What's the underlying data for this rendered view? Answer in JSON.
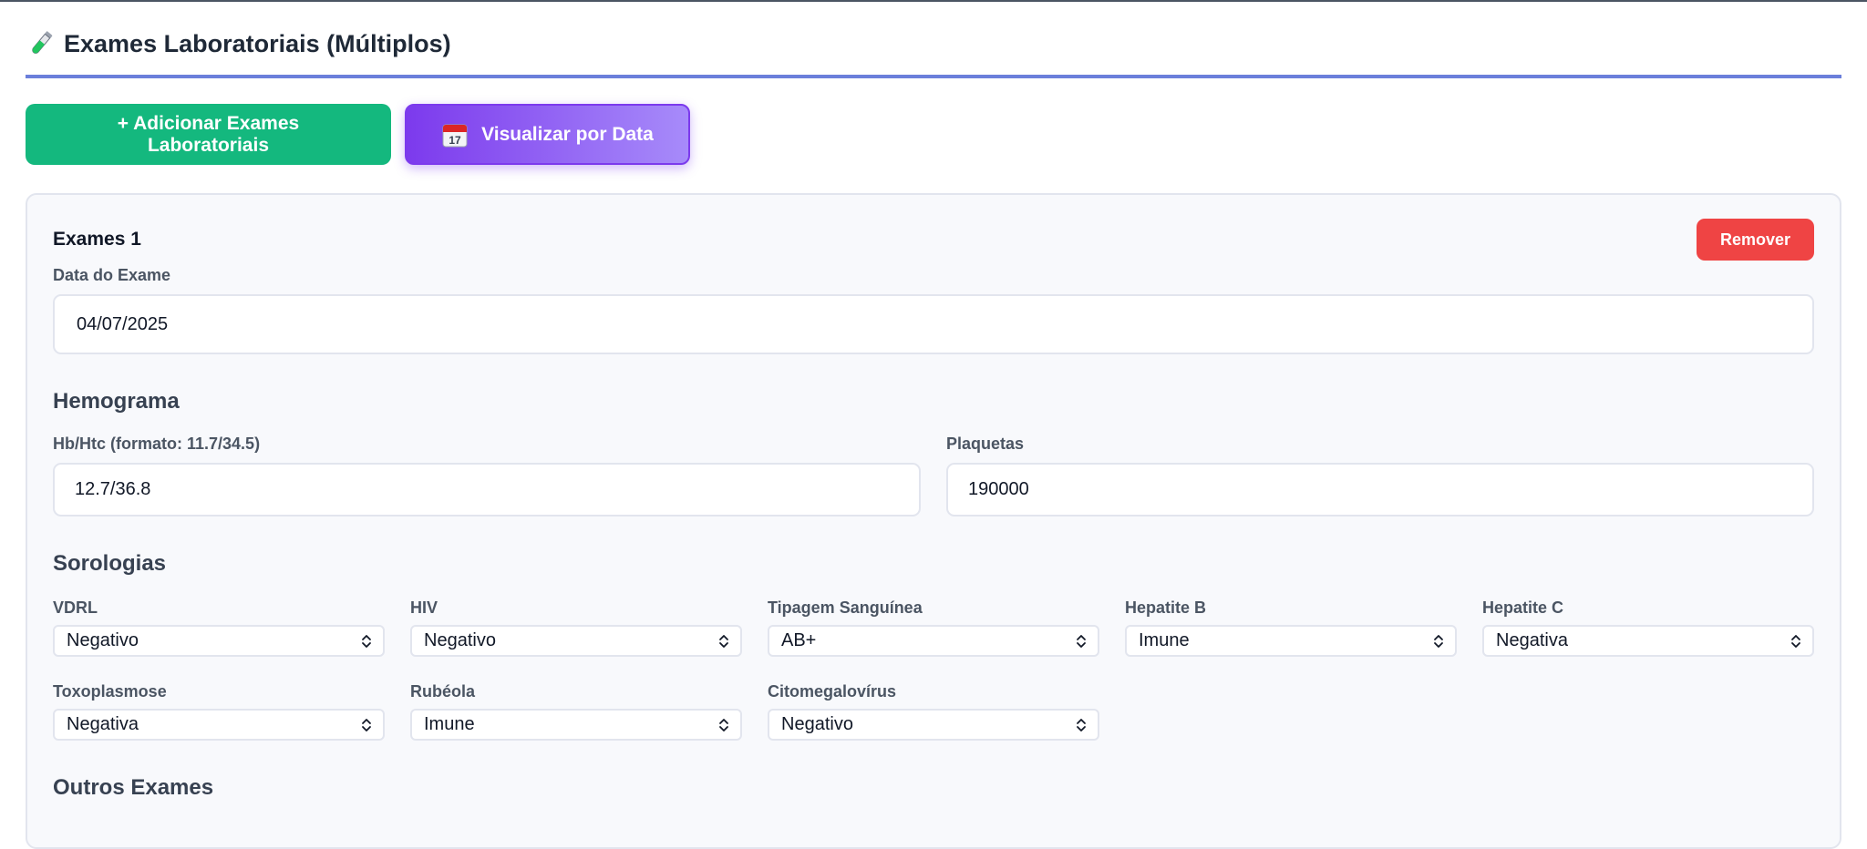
{
  "header": {
    "title": "Exames Laboratoriais (Múltiplos)",
    "icon": "test-tube-icon"
  },
  "actions": {
    "add_label": "+ Adicionar Exames Laboratoriais",
    "view_label": "Visualizar por Data",
    "view_icon": "calendar-icon",
    "calendar_day": "17"
  },
  "exam": {
    "title": "Exames 1",
    "remove_label": "Remover",
    "date_label": "Data do Exame",
    "date_value": "04/07/2025"
  },
  "hemograma": {
    "title": "Hemograma",
    "hb_label": "Hb/Htc (formato: 11.7/34.5)",
    "hb_value": "12.7/36.8",
    "plaq_label": "Plaquetas",
    "plaq_value": "190000"
  },
  "sorologias": {
    "title": "Sorologias",
    "items": [
      {
        "label": "VDRL",
        "value": "Negativo"
      },
      {
        "label": "HIV",
        "value": "Negativo"
      },
      {
        "label": "Tipagem Sanguínea",
        "value": "AB+"
      },
      {
        "label": "Hepatite B",
        "value": "Imune"
      },
      {
        "label": "Hepatite C",
        "value": "Negativa"
      },
      {
        "label": "Toxoplasmose",
        "value": "Negativa"
      },
      {
        "label": "Rubéola",
        "value": "Imune"
      },
      {
        "label": "Citomegalovírus",
        "value": "Negativo"
      }
    ]
  },
  "outros": {
    "title": "Outros Exames"
  },
  "colors": {
    "accent_line": "#6b7fdb",
    "add_button": "#14b87e",
    "view_button": "#7c3aed",
    "remove_button": "#ef4444"
  }
}
